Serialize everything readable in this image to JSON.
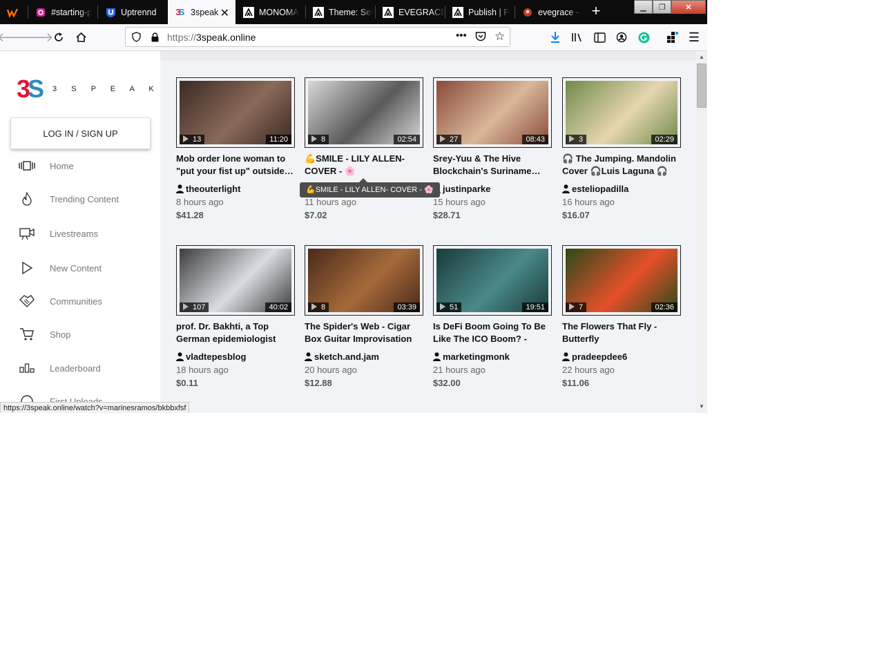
{
  "browser": {
    "tabs": [
      {
        "label": "",
        "icon": "w-icon",
        "color": "#ff6d00"
      },
      {
        "label": "#starting-p",
        "icon": "instagram-icon",
        "color": "#d6249f"
      },
      {
        "label": "Uptrennd",
        "icon": "uptrennd-icon",
        "color": "#2a6ae9"
      },
      {
        "label": "3speak",
        "icon": "3speak-icon",
        "color": "#e31337",
        "active": true
      },
      {
        "label": "MONOMA",
        "icon": "hive-icon",
        "color": "#ffffff"
      },
      {
        "label": "Theme: Sel",
        "icon": "hive-icon",
        "color": "#ffffff"
      },
      {
        "label": "EVEGRACE",
        "icon": "hive-icon",
        "color": "#ffffff"
      },
      {
        "label": "Publish | P",
        "icon": "hive-icon",
        "color": "#ffffff"
      },
      {
        "label": "evegrace –",
        "icon": "avatar-icon",
        "color": "#c0392b"
      }
    ],
    "url_scheme": "https://",
    "url_host": "3speak.online",
    "status_url": "https://3speak.online/watch?v=marinesramos/bkbbxfsf"
  },
  "sidebar": {
    "logo_text": "3 S P E A K",
    "logo_mark_3": "3",
    "logo_mark_s": "S",
    "login_label": "LOG IN / SIGN UP",
    "items": [
      {
        "label": "Home",
        "icon": "home-icon"
      },
      {
        "label": "Trending Content",
        "icon": "fire-icon"
      },
      {
        "label": "Livestreams",
        "icon": "camera-icon"
      },
      {
        "label": "New Content",
        "icon": "play-icon"
      },
      {
        "label": "Communities",
        "icon": "handshake-icon"
      },
      {
        "label": "Shop",
        "icon": "cart-icon"
      },
      {
        "label": "Leaderboard",
        "icon": "leaderboard-icon"
      },
      {
        "label": "First Uploads",
        "icon": "upload-icon"
      }
    ]
  },
  "videos": [
    {
      "title": "Mob order lone woman to \"put your fist up\" outside…",
      "author": "theouterlight",
      "time": "8 hours ago",
      "payout": "$41.28",
      "views": "13",
      "duration": "11:20",
      "thumb_colors": [
        "#3a2a24",
        "#8a6a58"
      ]
    },
    {
      "title": "💪SMILE - LILY ALLEN- COVER - 🌸",
      "author": "",
      "time": "11 hours ago",
      "payout": "$7.02",
      "views": "8",
      "duration": "02:54",
      "thumb_colors": [
        "#d8d8d8",
        "#5a5a5a"
      ]
    },
    {
      "title": "Srey-Yuu & The Hive Blockchain's Suriname…",
      "author": "justinparke",
      "time": "15 hours ago",
      "payout": "$28.71",
      "views": "27",
      "duration": "08:43",
      "thumb_colors": [
        "#8a4a3a",
        "#d9b89a"
      ]
    },
    {
      "title": "🎧 The Jumping. Mandolin Cover 🎧Luis Laguna 🎧",
      "author": "esteliopadilla",
      "time": "16 hours ago",
      "payout": "$16.07",
      "views": "3",
      "duration": "02:29",
      "thumb_colors": [
        "#6e8a4a",
        "#e6d6b0"
      ]
    },
    {
      "title": "prof. Dr. Bakhti, a Top German epidemiologist on…",
      "author": "vladtepesblog",
      "time": "18 hours ago",
      "payout": "$0.11",
      "views": "107",
      "duration": "40:02",
      "thumb_colors": [
        "#3c3c3c",
        "#d9dde3"
      ]
    },
    {
      "title": "The Spider's Web - Cigar Box Guitar Improvisation",
      "author": "sketch.and.jam",
      "time": "20 hours ago",
      "payout": "$12.88",
      "views": "8",
      "duration": "03:39",
      "thumb_colors": [
        "#4a2a1a",
        "#a66a3a"
      ]
    },
    {
      "title": "Is DeFi Boom Going To Be Like The ICO Boom? - Chri…",
      "author": "marketingmonk",
      "time": "21 hours ago",
      "payout": "$32.00",
      "views": "51",
      "duration": "19:51",
      "thumb_colors": [
        "#1a3a3a",
        "#4a8a8a"
      ]
    },
    {
      "title": "The Flowers That Fly - Butterfly",
      "author": "pradeepdee6",
      "time": "22 hours ago",
      "payout": "$11.06",
      "views": "7",
      "duration": "02:36",
      "thumb_colors": [
        "#2a4a1a",
        "#e6502a"
      ]
    }
  ],
  "tooltip": "💪SMILE - LILY ALLEN- COVER - 🌸",
  "colors": {
    "brand_red": "#e31337",
    "brand_blue": "#2e8bc0",
    "content_bg": "#f1f3f6"
  }
}
